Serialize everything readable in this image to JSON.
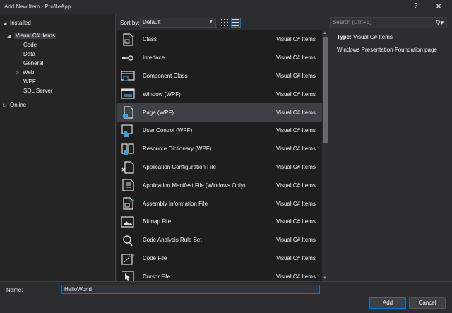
{
  "window": {
    "title": "Add New Item - ProfileApp",
    "help": "?",
    "close": "✕"
  },
  "tree": {
    "installed": "Installed",
    "visual_csharp": "Visual C# Items",
    "code": "Code",
    "data": "Data",
    "general": "General",
    "web": "Web",
    "wpf": "WPF",
    "sql_server": "SQL Server",
    "online": "Online"
  },
  "toolbar": {
    "sort_label": "Sort by:",
    "sort_value": "Default",
    "search_placeholder": "Search (Ctrl+E)"
  },
  "items": [
    {
      "name": "Class",
      "category": "Visual C# Items",
      "icon": "class-icon"
    },
    {
      "name": "Interface",
      "category": "Visual C# Items",
      "icon": "interface-icon"
    },
    {
      "name": "Component Class",
      "category": "Visual C# Items",
      "icon": "component-class-icon"
    },
    {
      "name": "Window (WPF)",
      "category": "Visual C# Items",
      "icon": "window-icon"
    },
    {
      "name": "Page (WPF)",
      "category": "Visual C# Items",
      "icon": "page-icon",
      "selected": true
    },
    {
      "name": "User Control (WPF)",
      "category": "Visual C# Items",
      "icon": "user-control-icon"
    },
    {
      "name": "Resource Dictionary (WPF)",
      "category": "Visual C# Items",
      "icon": "resource-dictionary-icon"
    },
    {
      "name": "Application Configuration File",
      "category": "Visual C# Items",
      "icon": "config-file-icon"
    },
    {
      "name": "Application Manifest File (Windows Only)",
      "category": "Visual C# Items",
      "icon": "manifest-file-icon"
    },
    {
      "name": "Assembly Information File",
      "category": "Visual C# Items",
      "icon": "assembly-info-icon"
    },
    {
      "name": "Bitmap File",
      "category": "Visual C# Items",
      "icon": "bitmap-icon"
    },
    {
      "name": "Code Analysis Rule Set",
      "category": "Visual C# Items",
      "icon": "rule-set-icon"
    },
    {
      "name": "Code File",
      "category": "Visual C# Items",
      "icon": "code-file-icon"
    },
    {
      "name": "Cursor File",
      "category": "Visual C# Items",
      "icon": "cursor-file-icon"
    }
  ],
  "detail": {
    "type_label": "Type:",
    "type_value": "Visual C# Items",
    "description": "Windows Presentation Foundation page"
  },
  "bottom": {
    "name_label": "Name:",
    "name_value": "HelloWorld",
    "add_label": "Add",
    "cancel_label": "Cancel"
  },
  "colors": {
    "accent": "#007acc",
    "background": "#2d2d30",
    "list_background": "#1e1e1e",
    "selection": "#3f3f46",
    "icon_green": "#3fa33a"
  }
}
